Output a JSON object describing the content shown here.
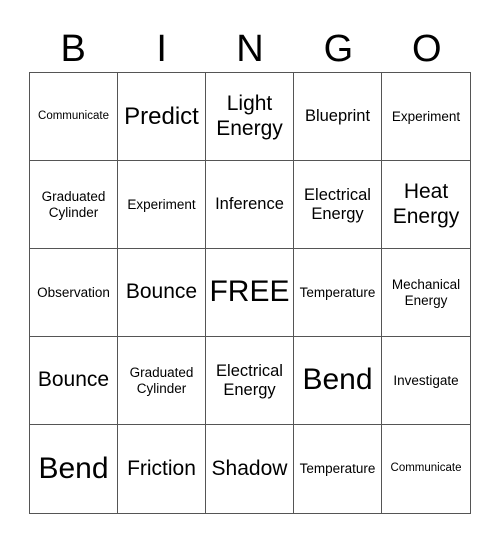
{
  "header": [
    "B",
    "I",
    "N",
    "G",
    "O"
  ],
  "cells": [
    {
      "text": "Communicate",
      "size": "s-xs"
    },
    {
      "text": "Predict",
      "size": "s-xl"
    },
    {
      "text": "Light Energy",
      "size": "s-lg"
    },
    {
      "text": "Blueprint",
      "size": "s-md"
    },
    {
      "text": "Experiment",
      "size": "s-sm"
    },
    {
      "text": "Graduated Cylinder",
      "size": "s-sm"
    },
    {
      "text": "Experiment",
      "size": "s-sm"
    },
    {
      "text": "Inference",
      "size": "s-md"
    },
    {
      "text": "Electrical Energy",
      "size": "s-md"
    },
    {
      "text": "Heat Energy",
      "size": "s-lg"
    },
    {
      "text": "Observation",
      "size": "s-sm"
    },
    {
      "text": "Bounce",
      "size": "s-lg"
    },
    {
      "text": "FREE",
      "size": "s-xxl"
    },
    {
      "text": "Temperature",
      "size": "s-sm"
    },
    {
      "text": "Mechanical Energy",
      "size": "s-sm"
    },
    {
      "text": "Bounce",
      "size": "s-lg"
    },
    {
      "text": "Graduated Cylinder",
      "size": "s-sm"
    },
    {
      "text": "Electrical Energy",
      "size": "s-md"
    },
    {
      "text": "Bend",
      "size": "s-xxl"
    },
    {
      "text": "Investigate",
      "size": "s-sm"
    },
    {
      "text": "Bend",
      "size": "s-xxl"
    },
    {
      "text": "Friction",
      "size": "s-lg"
    },
    {
      "text": "Shadow",
      "size": "s-lg"
    },
    {
      "text": "Temperature",
      "size": "s-sm"
    },
    {
      "text": "Communicate",
      "size": "s-xs"
    }
  ]
}
